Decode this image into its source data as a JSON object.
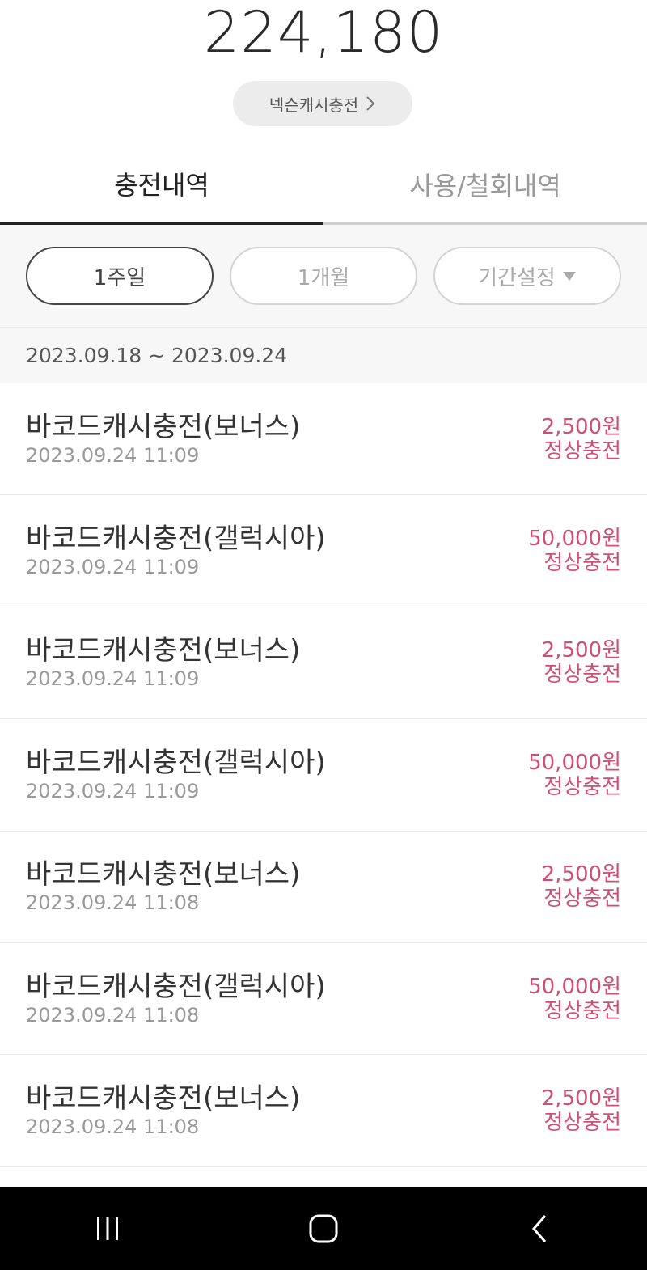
{
  "header": {
    "balance": "224,180",
    "charge_button_label": "넥슨캐시충전"
  },
  "tabs": [
    {
      "label": "충전내역",
      "active": true
    },
    {
      "label": "사용/철회내역",
      "active": false
    }
  ],
  "filters": {
    "options": [
      {
        "label": "1주일",
        "active": true
      },
      {
        "label": "1개월",
        "active": false
      },
      {
        "label": "기간설정",
        "active": false
      }
    ],
    "range": "2023.09.18 ~ 2023.09.24"
  },
  "history": [
    {
      "title": "바코드캐시충전(보너스)",
      "time": "2023.09.24 11:09",
      "amount": "2,500원",
      "status": "정상충전"
    },
    {
      "title": "바코드캐시충전(갤럭시아)",
      "time": "2023.09.24 11:09",
      "amount": "50,000원",
      "status": "정상충전"
    },
    {
      "title": "바코드캐시충전(보너스)",
      "time": "2023.09.24 11:09",
      "amount": "2,500원",
      "status": "정상충전"
    },
    {
      "title": "바코드캐시충전(갤럭시아)",
      "time": "2023.09.24 11:09",
      "amount": "50,000원",
      "status": "정상충전"
    },
    {
      "title": "바코드캐시충전(보너스)",
      "time": "2023.09.24 11:08",
      "amount": "2,500원",
      "status": "정상충전"
    },
    {
      "title": "바코드캐시충전(갤럭시아)",
      "time": "2023.09.24 11:08",
      "amount": "50,000원",
      "status": "정상충전"
    },
    {
      "title": "바코드캐시충전(보너스)",
      "time": "2023.09.24 11:08",
      "amount": "2,500원",
      "status": "정상충전"
    }
  ],
  "colors": {
    "accent": "#d24d74",
    "navbar": "#000000"
  },
  "navbar": {
    "icons": [
      "recent-apps-icon",
      "home-icon",
      "back-icon"
    ]
  }
}
